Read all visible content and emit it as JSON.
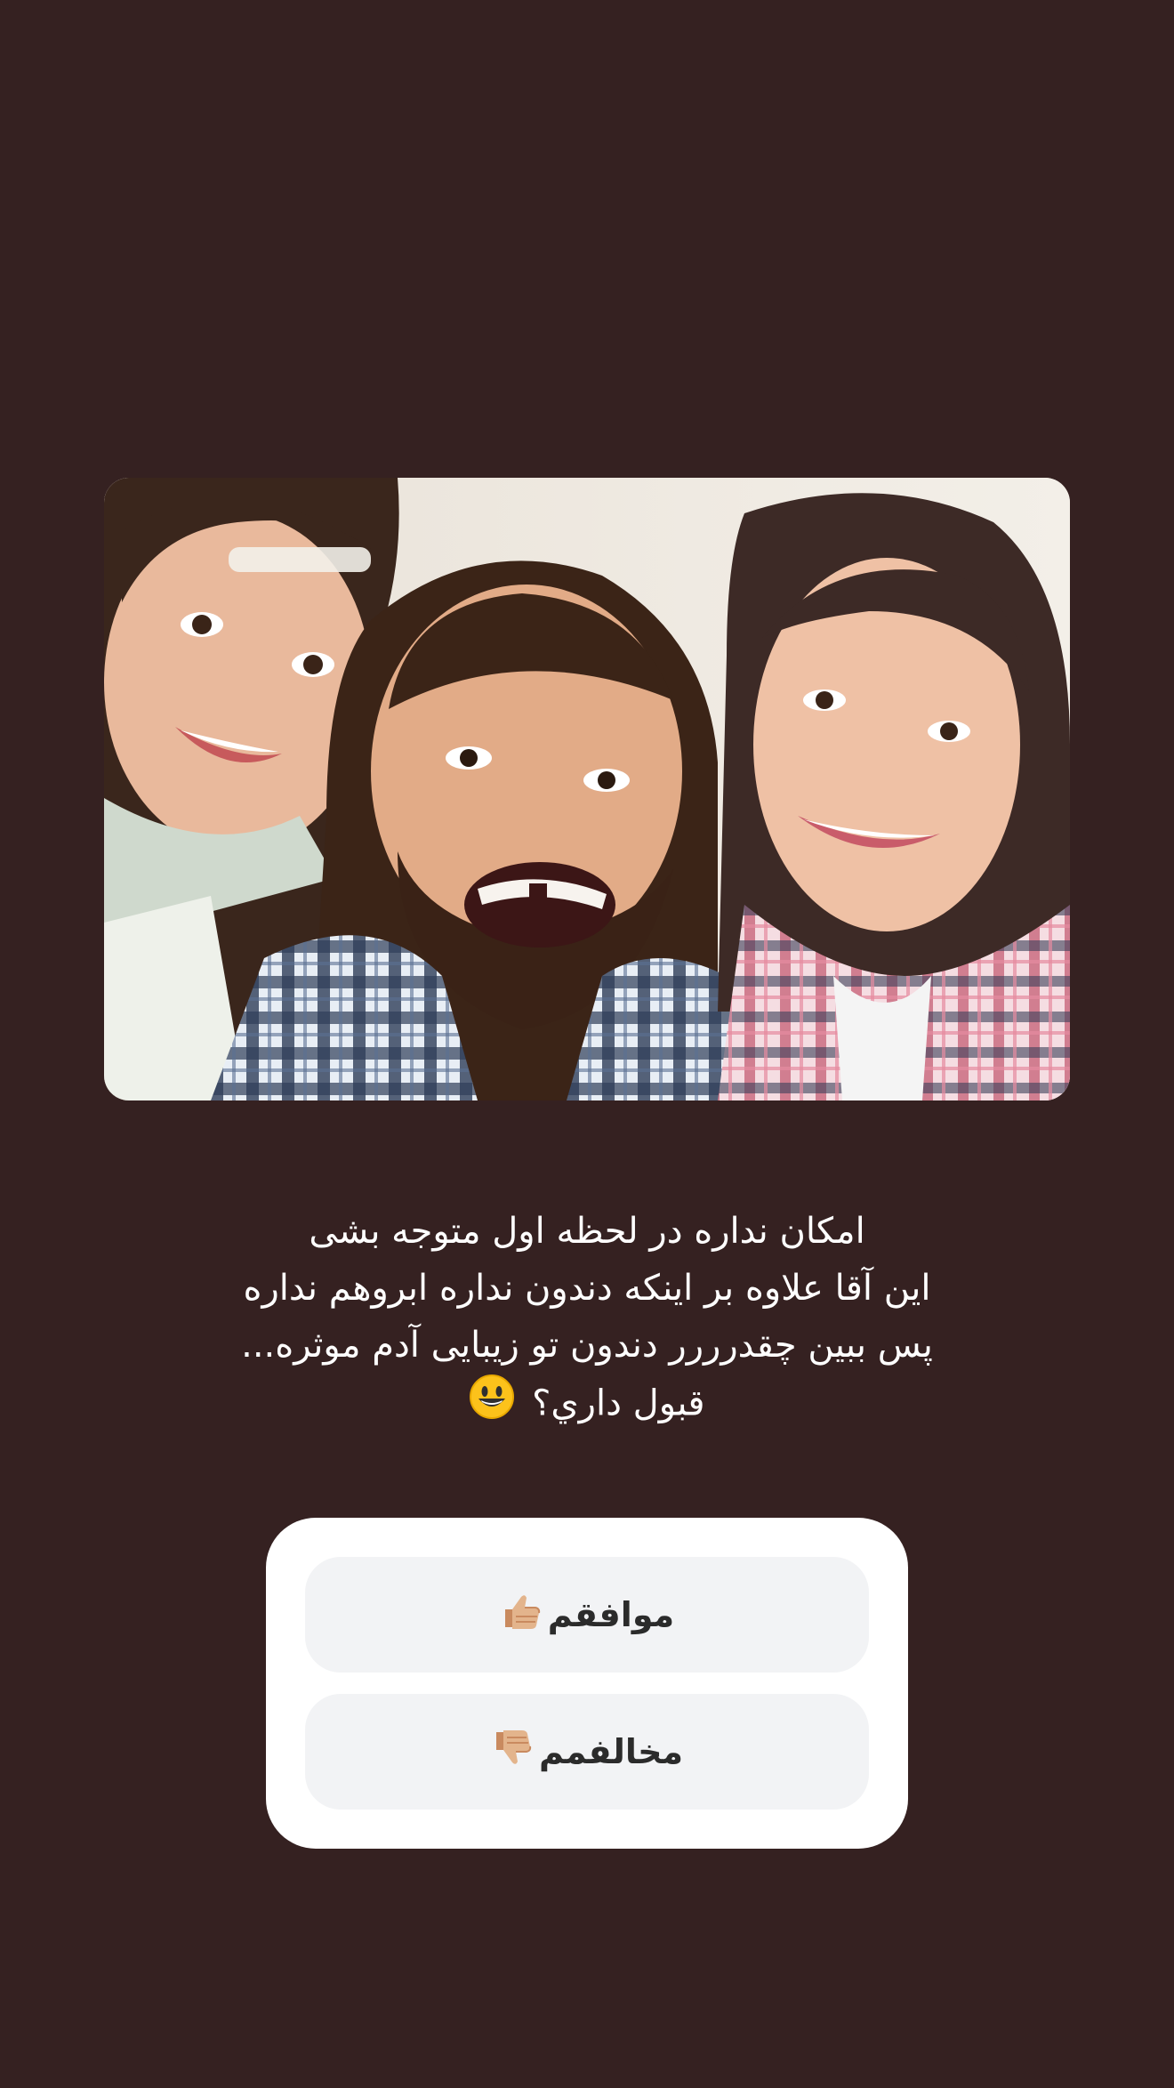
{
  "story": {
    "image": {
      "alt": "family-selfie-photo",
      "icon": "photo"
    },
    "caption": {
      "lines": [
        "امکان نداره در لحظه اول متوجه بشی",
        "این آقا علاوه بر اینکه دندون نداره ابروهم نداره",
        "پس ببین چقدرررر دندون تو زیبایی آدم موثره...",
        "قبول داري؟"
      ],
      "emoji": "smiley-face-icon"
    },
    "poll": {
      "options": [
        {
          "label": "موافقم",
          "icon": "thumbs-up-icon"
        },
        {
          "label": "مخالفمم",
          "icon": "thumbs-down-icon"
        }
      ]
    }
  },
  "colors": {
    "background": "#352121",
    "poll_card": "#ffffff",
    "option_bg": "#f2f3f5",
    "text_light": "#ffffff",
    "text_dark": "#2b2b2b"
  }
}
